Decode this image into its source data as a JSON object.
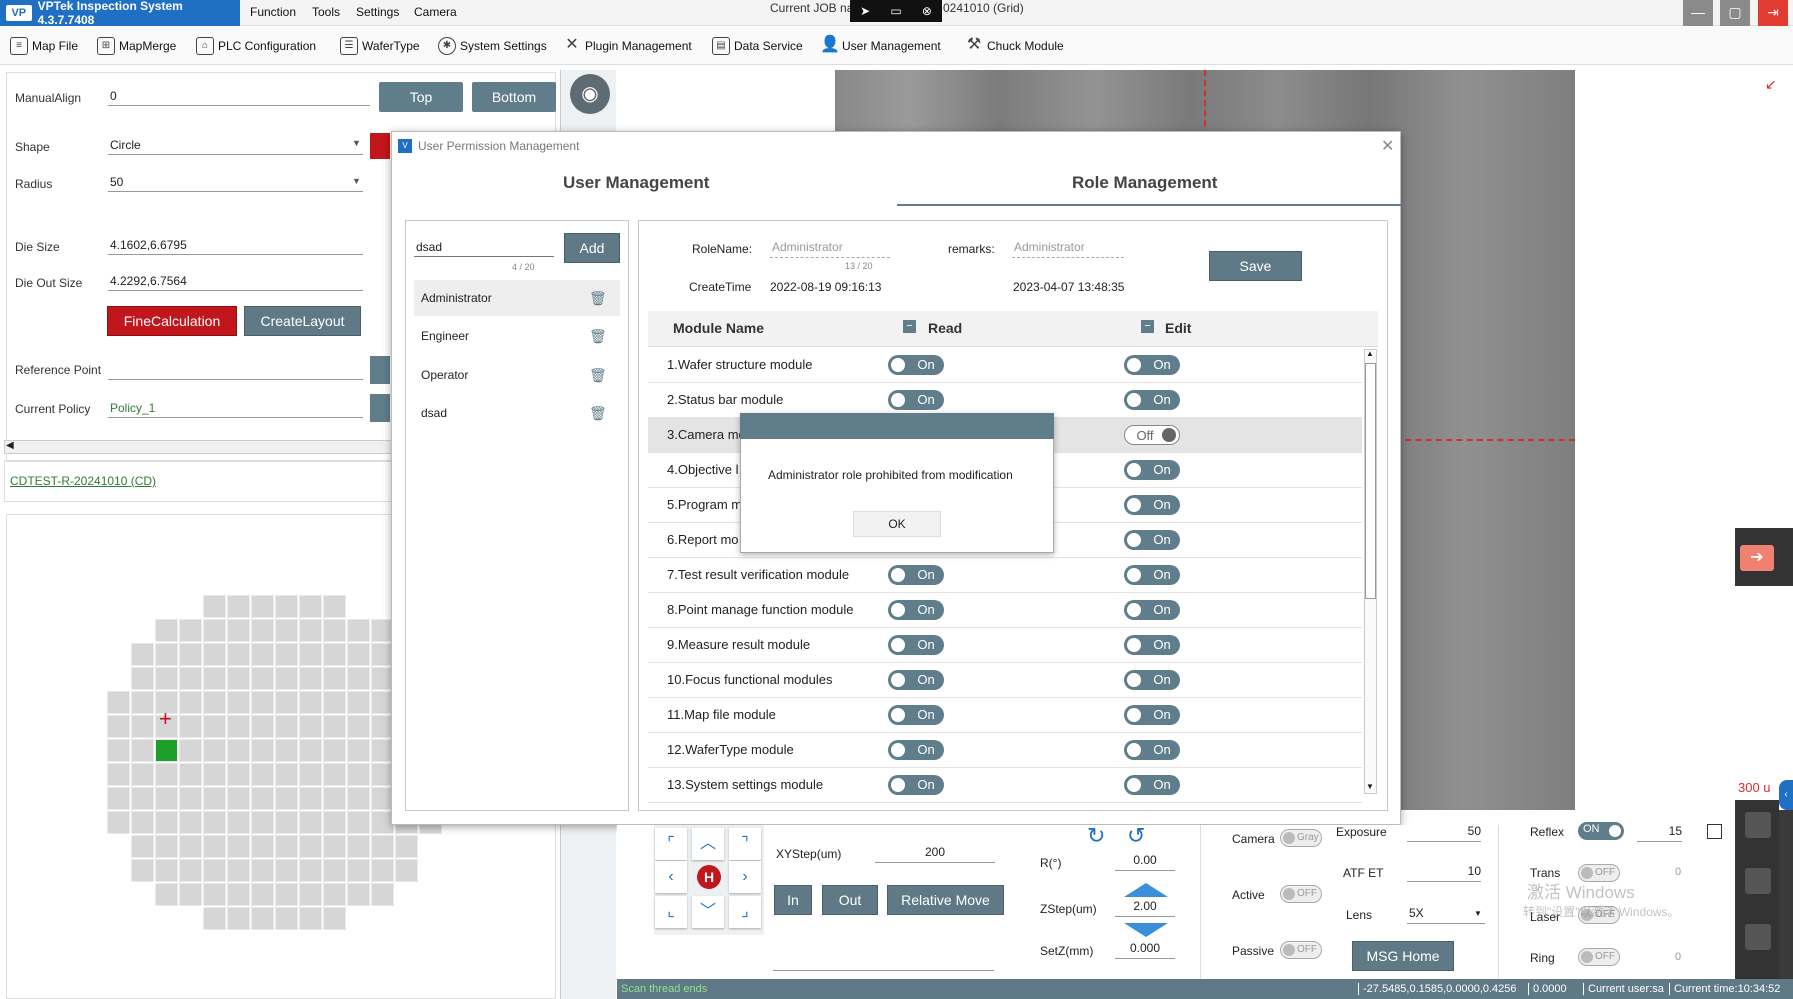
{
  "menubar": {
    "app_title": "VPTek Inspection System 4.3.7.7408",
    "logo_text": "VP",
    "items": [
      "Function",
      "Tools",
      "Settings",
      "Camera"
    ],
    "job_label": "Current JOB na",
    "job_suffix": "0241010 (Grid)"
  },
  "toolbar": {
    "items": [
      "Map File",
      "MapMerge",
      "PLC Configuration",
      "WaferType",
      "System Settings",
      "Plugin Management",
      "Data Service",
      "User Management",
      "Chuck Module"
    ]
  },
  "left_panel": {
    "manual_align_label": "ManualAlign",
    "manual_align_value": "0",
    "top_button": "Top",
    "bottom_button": "Bottom",
    "shape_label": "Shape",
    "shape_value": "Circle",
    "radius_label": "Radius",
    "radius_value": "50",
    "die_size_label": "Die Size",
    "die_size_value": "4.1602,6.6795",
    "die_out_size_label": "Die Out Size",
    "die_out_size_value": "4.2292,6.7564",
    "fine_calc_button": "FineCalculation",
    "create_layout_button": "CreateLayout",
    "reference_point_label": "Reference Point",
    "current_policy_label": "Current Policy",
    "current_policy_value": "Policy_1",
    "job_link": "CDTEST-R-20241010 (CD)"
  },
  "dialog": {
    "title": "User Permission Management",
    "tab_user": "User Management",
    "tab_role": "Role Management",
    "search_value": "dsad",
    "char_count": "4 / 20",
    "add_button": "Add",
    "roles": [
      "Administrator",
      "Engineer",
      "Operator",
      "dsad"
    ],
    "role_name_label": "RoleName:",
    "role_name_value": "Administrator",
    "role_name_count": "13 / 20",
    "remarks_label": "remarks:",
    "remarks_value": "Administrator",
    "create_time_label": "CreateTime",
    "create_time_value": "2022-08-19 09:16:13",
    "modify_time_value": "2023-04-07 13:48:35",
    "save_button": "Save",
    "col_module": "Module Name",
    "col_read": "Read",
    "col_edit": "Edit",
    "modules": [
      {
        "name": "1.Wafer structure module",
        "read": "On",
        "edit": "On"
      },
      {
        "name": "2.Status bar module",
        "read": "On",
        "edit": "On"
      },
      {
        "name": "3.Camera mo",
        "read": "",
        "edit": "Off"
      },
      {
        "name": "4.Objective l",
        "read": "",
        "edit": "On"
      },
      {
        "name": "5.Program m",
        "read": "",
        "edit": "On"
      },
      {
        "name": "6.Report mo",
        "read": "",
        "edit": "On"
      },
      {
        "name": "7.Test result verification module",
        "read": "On",
        "edit": "On"
      },
      {
        "name": "8.Point manage function module",
        "read": "On",
        "edit": "On"
      },
      {
        "name": "9.Measure result module",
        "read": "On",
        "edit": "On"
      },
      {
        "name": "10.Focus functional modules",
        "read": "On",
        "edit": "On"
      },
      {
        "name": "11.Map file module",
        "read": "On",
        "edit": "On"
      },
      {
        "name": "12.WaferType module",
        "read": "On",
        "edit": "On"
      },
      {
        "name": "13.System settings module",
        "read": "On",
        "edit": "On"
      }
    ]
  },
  "alert": {
    "message": "Administrator role prohibited from modification",
    "ok_button": "OK"
  },
  "motion": {
    "xystep_label": "XYStep(um)",
    "xystep_value": "200",
    "in_button": "In",
    "out_button": "Out",
    "relative_move_button": "Relative Move",
    "r_label": "R(°)",
    "r_value": "0.00",
    "zstep_label": "ZStep(um)",
    "zstep_value": "2.00",
    "setz_label": "SetZ(mm)",
    "setz_value": "0.000",
    "home_glyph": "H"
  },
  "camera_ctrl": {
    "camera_label": "Camera",
    "camera_toggle": "Gray",
    "exposure_label": "Exposure",
    "exposure_value": "50",
    "atf_label": "ATF ET",
    "atf_value": "10",
    "active_label": "Active",
    "active_toggle": "OFF",
    "lens_label": "Lens",
    "lens_value": "5X",
    "passive_label": "Passive",
    "passive_toggle": "OFF",
    "msg_home_button": "MSG Home",
    "reflex_label": "Reflex",
    "reflex_toggle": "ON",
    "reflex_value": "15",
    "trans_label": "Trans",
    "trans_toggle": "OFF",
    "trans_value": "0",
    "laser_label": "Laser",
    "laser_toggle": "OFF",
    "ring_label": "Ring",
    "ring_toggle": "OFF",
    "ring_value": "0",
    "scale_value": "300 u"
  },
  "watermark": {
    "line1": "激活 Windows",
    "line2": "转到\"设置\"以激活 Windows。"
  },
  "statusbar": {
    "left": "Scan thread ends",
    "coords": "-27.5485,0.1585,0.0000,0.4256",
    "value": "0.0000",
    "user": "Current user:sa",
    "time": "Current time:10:34:52"
  }
}
